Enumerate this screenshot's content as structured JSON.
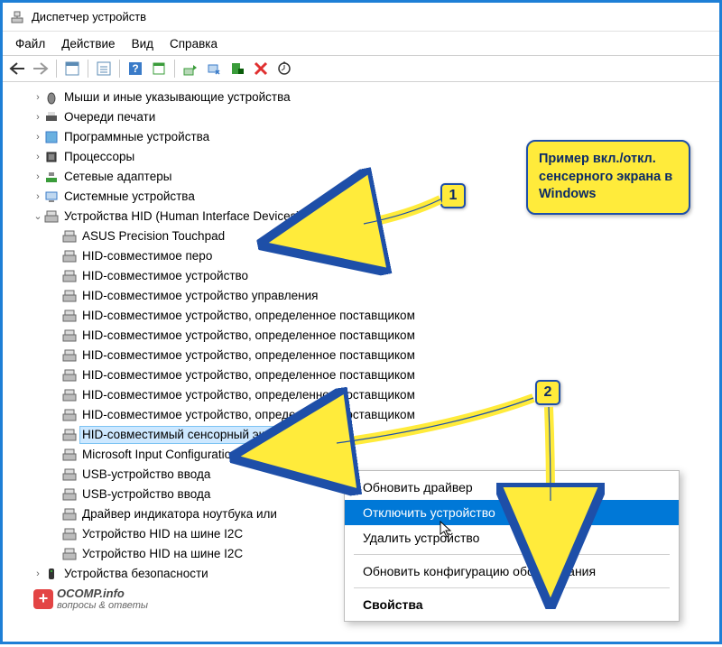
{
  "title": "Диспетчер устройств",
  "menu": {
    "file": "Файл",
    "action": "Действие",
    "view": "Вид",
    "help": "Справка"
  },
  "tree": {
    "n0": "Мыши и иные указывающие устройства",
    "n1": "Очереди печати",
    "n2": "Программные устройства",
    "n3": "Процессоры",
    "n4": "Сетевые адаптеры",
    "n5": "Системные устройства",
    "n6": "Устройства HID (Human Interface Devices)",
    "c0": "ASUS Precision Touchpad",
    "c1": "HID-совместимое перо",
    "c2": "HID-совместимое устройство",
    "c3": "HID-совместимое устройство управления",
    "c4": "HID-совместимое устройство, определенное поставщиком",
    "c5": "HID-совместимое устройство, определенное поставщиком",
    "c6": "HID-совместимое устройство, определенное поставщиком",
    "c7": "HID-совместимое устройство, определенное поставщиком",
    "c8": "HID-совместимое устройство, определенное поставщиком",
    "c9": "HID-совместимое устройство, определенное поставщиком",
    "c10": "HID-совместимый сенсорный экран",
    "c11": "Microsoft Input Configuration Device",
    "c12": "USB-устройство ввода",
    "c13": "USB-устройство ввода",
    "c14": "Драйвер индикатора ноутбука или",
    "c15": "Устройство HID на шине I2C",
    "c16": "Устройство HID на шине I2C",
    "n7": "Устройства безопасности"
  },
  "ctx": {
    "i0": "Обновить драйвер",
    "i1": "Отключить устройство",
    "i2": "Удалить устройство",
    "i3": "Обновить конфигурацию оборудования",
    "i4": "Свойства"
  },
  "callout": "Пример вкл./откл. сенсерного экрана в Windows",
  "badge1": "1",
  "badge2": "2",
  "watermark": {
    "brand": "OCOMP.info",
    "sub": "вопросы & ответы"
  }
}
